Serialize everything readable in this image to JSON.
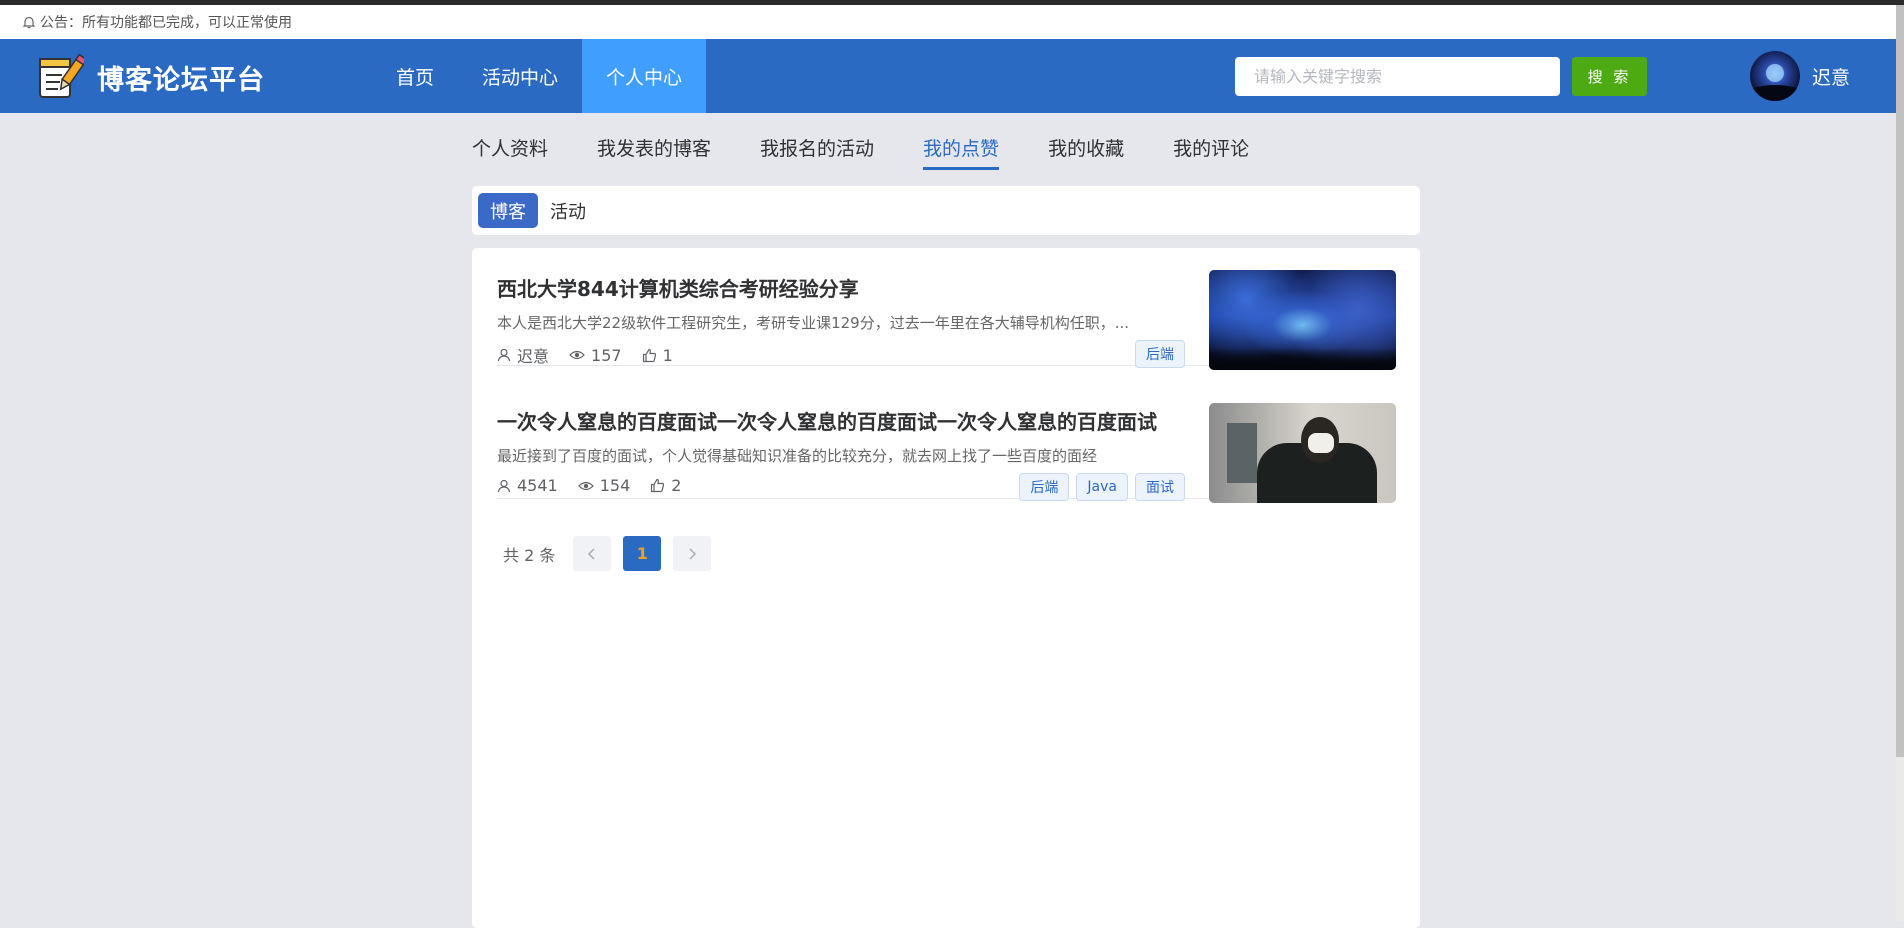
{
  "notice": {
    "text": "公告：所有功能都已完成，可以正常使用"
  },
  "header": {
    "brand": "博客论坛平台",
    "nav": [
      {
        "label": "首页",
        "active": false
      },
      {
        "label": "活动中心",
        "active": false
      },
      {
        "label": "个人中心",
        "active": true
      }
    ],
    "search_placeholder": "请输入关键字搜索",
    "search_button": "搜 索",
    "username": "迟意"
  },
  "subnav": [
    {
      "label": "个人资料",
      "active": false
    },
    {
      "label": "我发表的博客",
      "active": false
    },
    {
      "label": "我报名的活动",
      "active": false
    },
    {
      "label": "我的点赞",
      "active": true
    },
    {
      "label": "我的收藏",
      "active": false
    },
    {
      "label": "我的评论",
      "active": false
    }
  ],
  "filter": {
    "blog": "博客",
    "activity": "活动",
    "selected": "博客"
  },
  "posts": [
    {
      "title": "西北大学844计算机类综合考研经验分享",
      "summary": "本人是西北大学22级软件工程研究生，考研专业课129分，过去一年里在各大辅导机构任职，...",
      "author": "迟意",
      "views": "157",
      "likes": "1",
      "tags": [
        "后端"
      ]
    },
    {
      "title": "一次令人窒息的百度面试一次令人窒息的百度面试一次令人窒息的百度面试",
      "summary": "最近接到了百度的面试，个人觉得基础知识准备的比较充分，就去网上找了一些百度的面经",
      "author": "4541",
      "views": "154",
      "likes": "2",
      "tags": [
        "后端",
        "Java",
        "面试"
      ]
    }
  ],
  "pagination": {
    "total_text": "共 2 条",
    "current_page": "1",
    "prev": "<",
    "next": ">"
  },
  "colors": {
    "header": "#2b6ac3",
    "nav_active": "#409eff",
    "search_button": "#4eaa12",
    "tag_text": "#2b6ac3"
  }
}
